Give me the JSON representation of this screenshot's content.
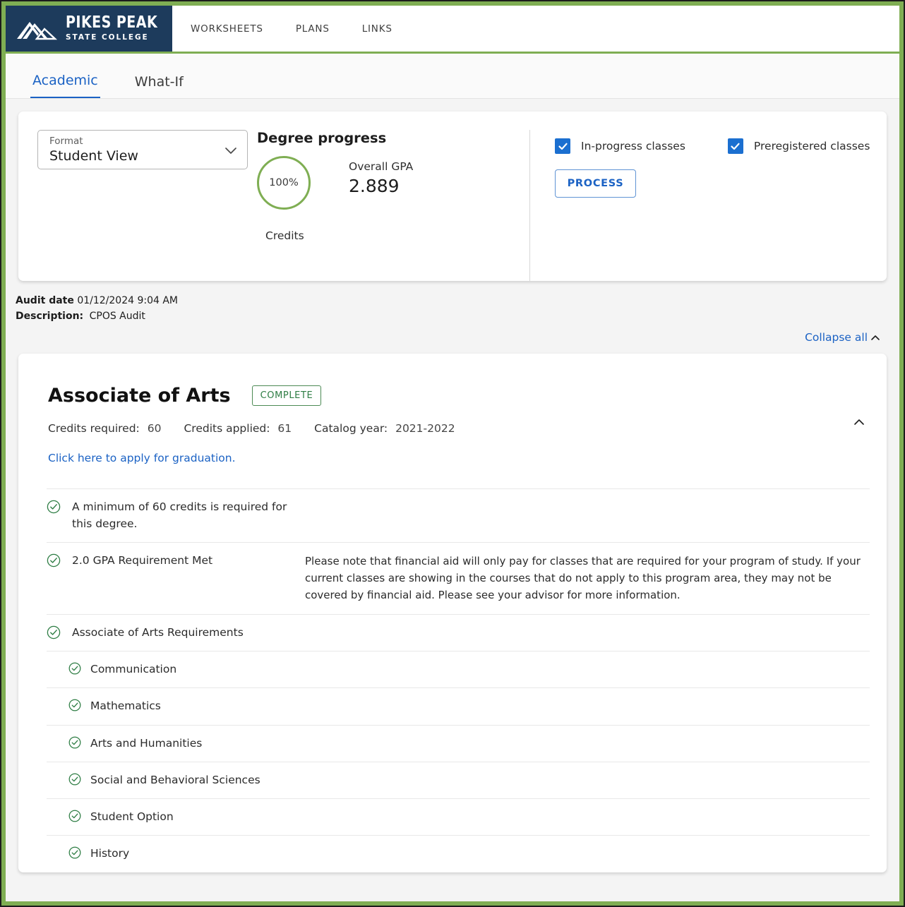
{
  "brand": {
    "title": "PIKES PEAK",
    "subtitle": "STATE COLLEGE",
    "logo_icon": "mountain-logo-icon",
    "navy": "#1d3b5c",
    "green": "#7fae53"
  },
  "nav": {
    "items": [
      {
        "label": "WORKSHEETS"
      },
      {
        "label": "PLANS"
      },
      {
        "label": "LINKS"
      }
    ]
  },
  "tabs": [
    {
      "label": "Academic",
      "active": true
    },
    {
      "label": "What-If",
      "active": false
    }
  ],
  "format_select": {
    "label": "Format",
    "value": "Student View",
    "icon": "chevron-down-icon"
  },
  "degree_progress": {
    "title": "Degree progress",
    "percent": "100%",
    "gpa_label": "Overall GPA",
    "gpa_value": "2.889",
    "credits_label": "Credits"
  },
  "options": {
    "checkboxes": [
      {
        "label": "In-progress classes",
        "checked": true
      },
      {
        "label": "Preregistered classes",
        "checked": true
      }
    ],
    "process_label": "PROCESS"
  },
  "audit": {
    "date_label": "Audit date",
    "date_value": "01/12/2024 9:04 AM",
    "description_label": "Description:",
    "description_value": "CPOS Audit",
    "collapse_all": "Collapse all",
    "collapse_icon": "chevron-up-icon"
  },
  "degree": {
    "title": "Associate of Arts",
    "status_badge": "COMPLETE",
    "collapse_icon": "chevron-up-icon",
    "meta": [
      {
        "label": "Credits required:",
        "value": "60"
      },
      {
        "label": "Credits applied:",
        "value": "61"
      },
      {
        "label": "Catalog year:",
        "value": "2021-2022"
      }
    ],
    "graduation_link": "Click here to apply for graduation.",
    "requirements": [
      {
        "icon": "check-circle-icon",
        "text": "A minimum of 60 credits is required for this degree.",
        "note": "",
        "level": "top"
      },
      {
        "icon": "check-circle-icon",
        "text": "2.0 GPA Requirement Met",
        "note": "Please note that financial aid will only pay for classes that are required for your program of study. If your current classes are showing in the courses that do not apply to this program area, they may not be covered by financial aid. Please see your advisor for more information.",
        "level": "top"
      },
      {
        "icon": "check-circle-icon",
        "text": "Associate of Arts Requirements",
        "note": "",
        "level": "top"
      },
      {
        "icon": "check-circle-icon",
        "text": "Communication",
        "note": "",
        "level": "sub"
      },
      {
        "icon": "check-circle-icon",
        "text": "Mathematics",
        "note": "",
        "level": "sub"
      },
      {
        "icon": "check-circle-icon",
        "text": "Arts and Humanities",
        "note": "",
        "level": "sub"
      },
      {
        "icon": "check-circle-icon",
        "text": "Social and Behavioral Sciences",
        "note": "",
        "level": "sub"
      },
      {
        "icon": "check-circle-icon",
        "text": "Student Option",
        "note": "",
        "level": "sub"
      },
      {
        "icon": "check-circle-icon",
        "text": "History",
        "note": "",
        "level": "sub"
      }
    ]
  }
}
